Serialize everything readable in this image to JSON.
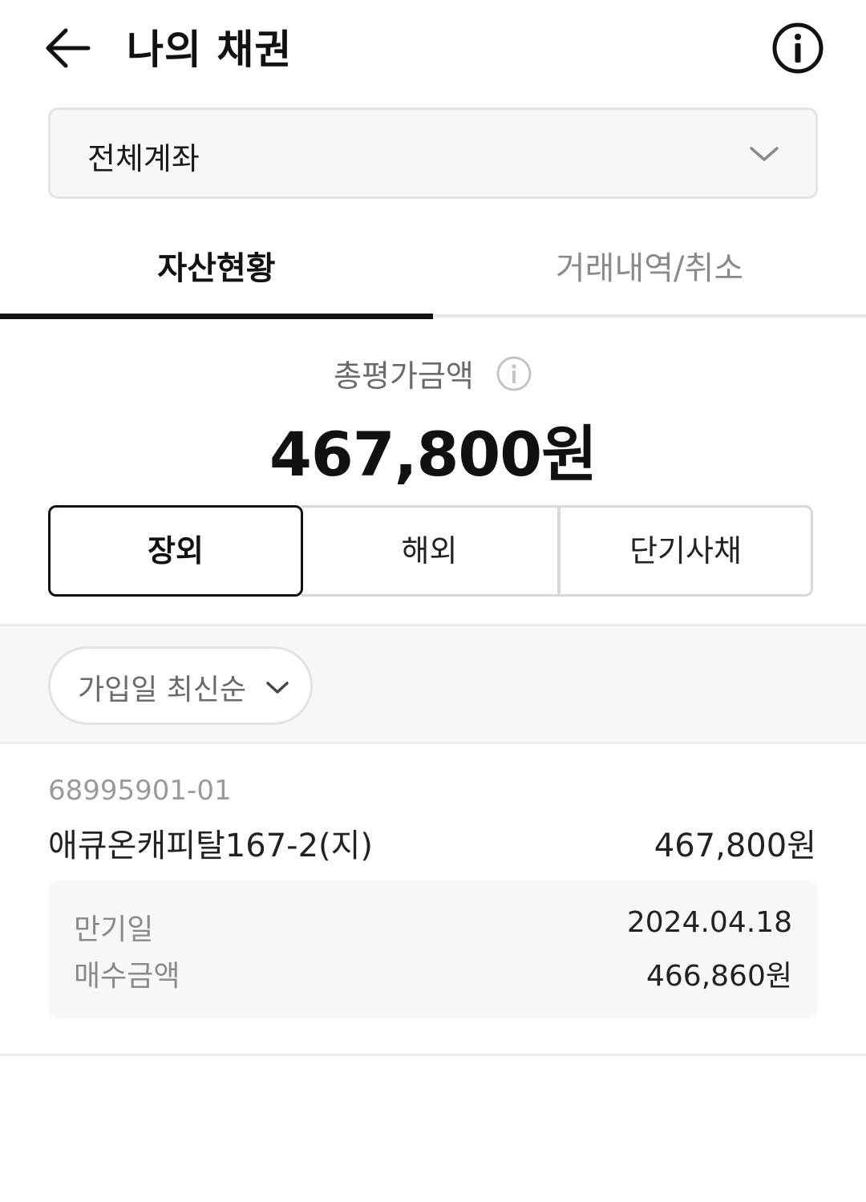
{
  "header": {
    "title": "나의 채권",
    "back_icon": "arrow-left-icon",
    "info_icon": "info-circle-icon"
  },
  "account_select": {
    "value": "전체계좌",
    "icon": "chevron-down-icon"
  },
  "tabs": [
    {
      "label": "자산현황",
      "active": true
    },
    {
      "label": "거래내역/취소",
      "active": false
    }
  ],
  "summary": {
    "total_label": "총평가금액",
    "total_amount": "467,800원",
    "info_icon": "info-circle-icon"
  },
  "segments": [
    {
      "label": "장외",
      "selected": true
    },
    {
      "label": "해외",
      "selected": false
    },
    {
      "label": "단기사채",
      "selected": false
    }
  ],
  "sort": {
    "label": "가입일 최신순",
    "icon": "chevron-down-icon"
  },
  "bonds": [
    {
      "code": "68995901-01",
      "name": "애큐온캐피탈167-2(지)",
      "value": "467,800원",
      "details": [
        {
          "label": "만기일",
          "value": "2024.04.18"
        },
        {
          "label": "매수금액",
          "value": "466,860원"
        }
      ]
    }
  ],
  "colors": {
    "primary_text": "#111111",
    "muted_text": "#8a8a8a",
    "panel_bg": "#f7f7f7",
    "border": "#e4e4e4"
  }
}
